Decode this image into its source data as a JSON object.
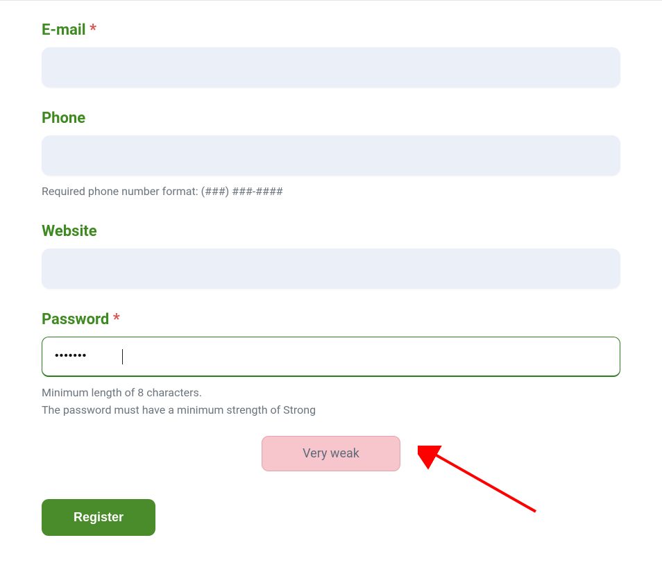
{
  "fields": {
    "email": {
      "label": "E-mail",
      "required_mark": "*",
      "value": ""
    },
    "phone": {
      "label": "Phone",
      "value": "",
      "help": "Required phone number format: (###) ###-####"
    },
    "website": {
      "label": "Website",
      "value": ""
    },
    "password": {
      "label": "Password",
      "required_mark": "*",
      "value": "•••••••",
      "help_line1": "Minimum length of 8 characters.",
      "help_line2": "The password must have a minimum strength of Strong",
      "strength_label": "Very weak"
    }
  },
  "actions": {
    "register_label": "Register"
  },
  "colors": {
    "label_green": "#3e8a20",
    "button_green": "#4a8b2c",
    "input_bg": "#ebeff8",
    "strength_bg": "#f7c6cc",
    "strength_border": "#e9a0a9",
    "help_text": "#6c757d",
    "required_red": "#d9534f",
    "arrow_red": "#ff0000"
  }
}
